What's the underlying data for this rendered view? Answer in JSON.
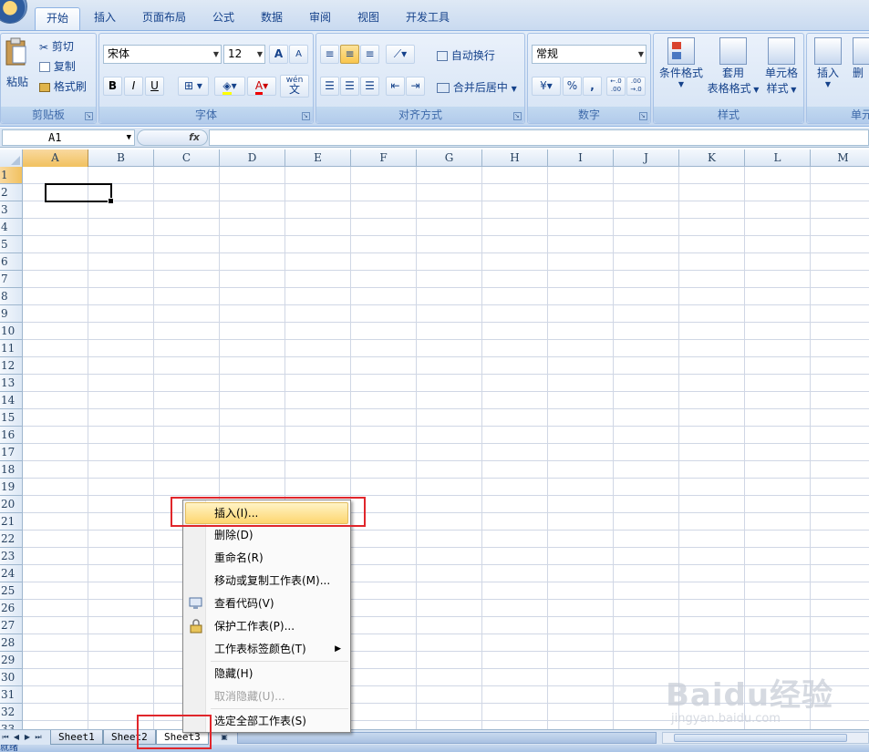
{
  "ribbon": {
    "tabs": [
      "开始",
      "插入",
      "页面布局",
      "公式",
      "数据",
      "审阅",
      "视图",
      "开发工具"
    ],
    "active_tab": "开始",
    "clipboard": {
      "paste": "粘贴",
      "cut": "剪切",
      "copy": "复制",
      "format_painter": "格式刷",
      "label": "剪贴板"
    },
    "font": {
      "name": "宋体",
      "size": "12",
      "grow": "A",
      "shrink": "A",
      "bold": "B",
      "italic": "I",
      "underline": "U",
      "wen": "wén",
      "wen_char": "文",
      "label": "字体"
    },
    "alignment": {
      "wrap_text": "自动换行",
      "merge_center": "合并后居中",
      "label": "对齐方式"
    },
    "number": {
      "format": "常规",
      "percent": "%",
      "comma": ",",
      "inc_decimal": "+.0 .00",
      "dec_decimal": ".00 →.0",
      "label": "数字"
    },
    "styles": {
      "conditional": "条件格式",
      "table_1": "套用",
      "table_2": "表格格式",
      "cell_1": "单元格",
      "cell_2": "样式",
      "label": "样式"
    },
    "cells": {
      "insert": "插入",
      "delete": "删",
      "label": "单元"
    }
  },
  "formula_bar": {
    "name_box": "A1",
    "fx": "fx",
    "formula": ""
  },
  "grid": {
    "columns": [
      "A",
      "B",
      "C",
      "D",
      "E",
      "F",
      "G",
      "H",
      "I",
      "J",
      "K",
      "L",
      "M"
    ],
    "rows": [
      "1",
      "2",
      "3",
      "4",
      "5",
      "6",
      "7",
      "8",
      "9",
      "10",
      "11",
      "12",
      "13",
      "14",
      "15",
      "16",
      "17",
      "18",
      "19",
      "20",
      "21",
      "22",
      "23",
      "24",
      "25",
      "26",
      "27",
      "28",
      "29",
      "30",
      "31",
      "32",
      "33"
    ],
    "selected_column": "A",
    "selected_row": "1"
  },
  "sheets": {
    "tabs": [
      "Sheet1",
      "Sheet2",
      "Sheet3"
    ],
    "active": "Sheet3"
  },
  "context_menu": {
    "items": [
      {
        "label": "插入(I)...",
        "state": "highlighted"
      },
      {
        "label": "删除(D)",
        "state": "normal"
      },
      {
        "label": "重命名(R)",
        "state": "normal"
      },
      {
        "label": "移动或复制工作表(M)...",
        "state": "normal"
      },
      {
        "label": "查看代码(V)",
        "state": "normal",
        "icon": "view-code-icon"
      },
      {
        "label": "保护工作表(P)...",
        "state": "normal",
        "icon": "protect-sheet-icon"
      },
      {
        "label": "工作表标签颜色(T)",
        "state": "normal",
        "submenu": true
      },
      {
        "label": "隐藏(H)",
        "state": "normal"
      },
      {
        "label": "取消隐藏(U)...",
        "state": "disabled"
      },
      {
        "label": "选定全部工作表(S)",
        "state": "normal"
      }
    ]
  },
  "status_bar": {
    "text": "就绪"
  },
  "watermark": {
    "text": "Baidu经验",
    "url": "jingyan.baidu.com"
  },
  "colors": {
    "highlight": "#fdd66f",
    "annotation": "#e0262b",
    "ribbon": "#dbe6f4"
  }
}
